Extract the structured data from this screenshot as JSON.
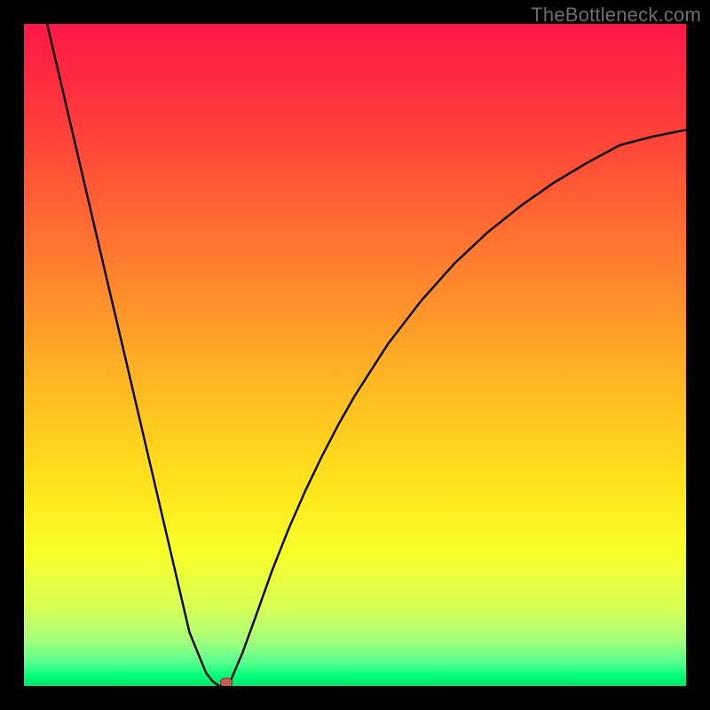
{
  "watermark": "TheBottleneck.com",
  "colors": {
    "frame": "#000000",
    "watermark": "#6e6e6e",
    "curve": "#000000",
    "marker_fill": "#c65a51",
    "marker_stroke": "#7a3a34",
    "gradient_stops": [
      {
        "offset": 0.0,
        "color": "#ff1848"
      },
      {
        "offset": 0.1,
        "color": "#ff2f3f"
      },
      {
        "offset": 0.25,
        "color": "#ff5a34"
      },
      {
        "offset": 0.4,
        "color": "#ff8a2e"
      },
      {
        "offset": 0.55,
        "color": "#ffba22"
      },
      {
        "offset": 0.7,
        "color": "#ffe41c"
      },
      {
        "offset": 0.8,
        "color": "#f8ff2a"
      },
      {
        "offset": 0.88,
        "color": "#d8ff55"
      },
      {
        "offset": 0.93,
        "color": "#a8ff7a"
      },
      {
        "offset": 0.965,
        "color": "#55ff8f"
      },
      {
        "offset": 0.985,
        "color": "#00ff78"
      },
      {
        "offset": 1.0,
        "color": "#00e06a"
      }
    ]
  },
  "chart_data": {
    "type": "line",
    "title": "",
    "xlabel": "",
    "ylabel": "",
    "x_range": [
      0,
      100
    ],
    "y_range": [
      0,
      100
    ],
    "x": [
      3.5,
      5,
      7.5,
      10,
      12.5,
      15,
      17.5,
      20,
      22.5,
      25,
      27.5,
      28.5,
      29.5,
      30.5,
      31,
      31.5,
      33,
      35,
      37.5,
      40,
      42.5,
      45,
      47.5,
      50,
      55,
      60,
      65,
      70,
      75,
      80,
      85,
      90,
      95,
      100
    ],
    "values": [
      100,
      93.6,
      82.9,
      72.2,
      61.5,
      50.9,
      40.2,
      29.5,
      18.8,
      8.1,
      2.0,
      0.7,
      0,
      0,
      0.3,
      1.5,
      5.0,
      10.5,
      17.5,
      23.8,
      29.5,
      34.7,
      39.5,
      43.9,
      51.7,
      58.2,
      63.8,
      68.5,
      72.5,
      76.0,
      79.0,
      81.7,
      83.0,
      84.0
    ],
    "minimum_point": {
      "x": 30.0,
      "y": 0
    },
    "marker": {
      "x": 30.5,
      "y": 0.5
    },
    "notes": "Curve shaped like a sharp V with minimum near x≈30%, rising asymptotically toward ~84% on the right; background is a vertical heat gradient from red (top, high bottleneck) to green (bottom, low bottleneck)."
  }
}
